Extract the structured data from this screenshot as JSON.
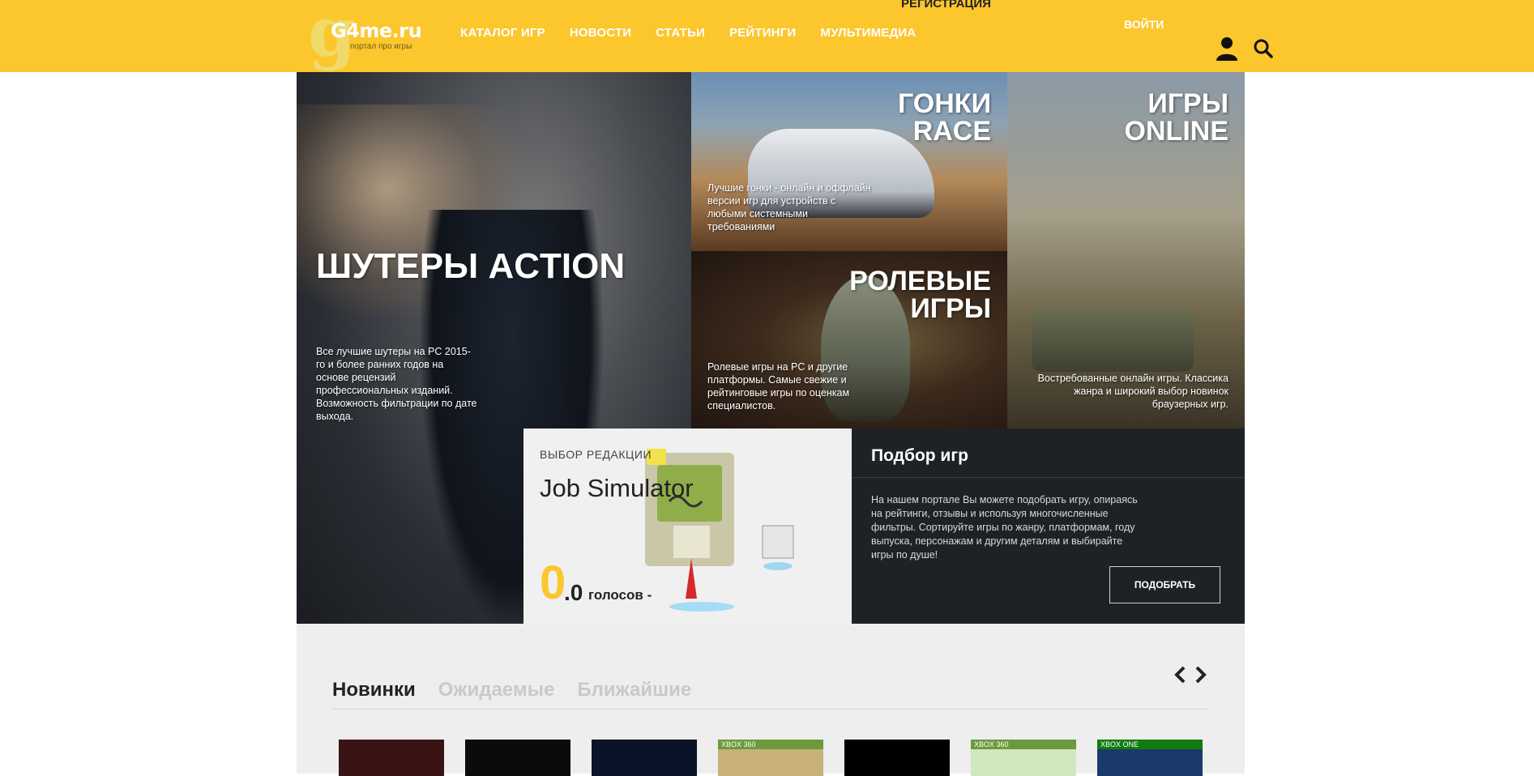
{
  "header": {
    "logo_name": "G4me.ru",
    "logo_tagline": "портал про игры",
    "nav": [
      "КАТАЛОГ ИГР",
      "НОВОСТИ",
      "СТАТЬИ",
      "РЕЙТИНГИ",
      "МУЛЬТИМЕДИА"
    ],
    "register": "РЕГИСТРАЦИЯ",
    "login": "ВОЙТИ",
    "user_icon": "user-icon",
    "search_icon": "search-icon"
  },
  "tiles": {
    "shooter": {
      "title": "ШУТЕРЫ ACTION",
      "desc": "Все лучшие шутеры на PC 2015-го и более ранних годов на основе рецензий профессиональных изданий. Возможность фильтрации по дате выхода."
    },
    "race": {
      "title_line1": "ГОНКИ",
      "title_line2": "RACE",
      "desc": "Лучшие гонки - онлайн и оффлайн версии игр для устройств с любыми системными требованиями"
    },
    "rpg": {
      "title_line1": "РОЛЕВЫЕ",
      "title_line2": "ИГРЫ",
      "desc": "Ролевые игры на PC и другие платформы. Самые свежие и рейтинговые игры по оценкам специалистов."
    },
    "online": {
      "title_line1": "ИГРЫ",
      "title_line2": "ONLINE",
      "desc": "Востребованные онлайн игры. Классика жанра и широкий выбор новинок браузерных игр."
    }
  },
  "editor": {
    "label": "ВЫБОР РЕДАКЦИИ",
    "game": "Job Simulator",
    "score_int": "0",
    "score_dec": ".0",
    "votes": "голосов -"
  },
  "picker": {
    "title": "Подбор игр",
    "text": "На нашем портале Вы можете подобрать игру, опираясь на рейтинги, отзывы и используя многочисленные фильтры. Сортируйте игры по жанру, платформам, году выпуска, персонажам и другим деталям и выбирайте игры по душе!",
    "button": "ПОДОБРАТЬ"
  },
  "bottom": {
    "tabs": [
      "Новинки",
      "Ожидаемые",
      "Ближайшие"
    ],
    "active_tab": "Новинки",
    "prev_icon": "chevron-left-icon",
    "next_icon": "chevron-right-icon",
    "cover_captions": [
      "",
      "",
      "",
      "XBOX 360",
      "",
      "XBOX 360",
      "XBOX ONE"
    ]
  },
  "colors": {
    "brand_yellow": "#fcc62d",
    "dark_panel": "#1f2225",
    "light_panel": "#f0f0f0"
  }
}
